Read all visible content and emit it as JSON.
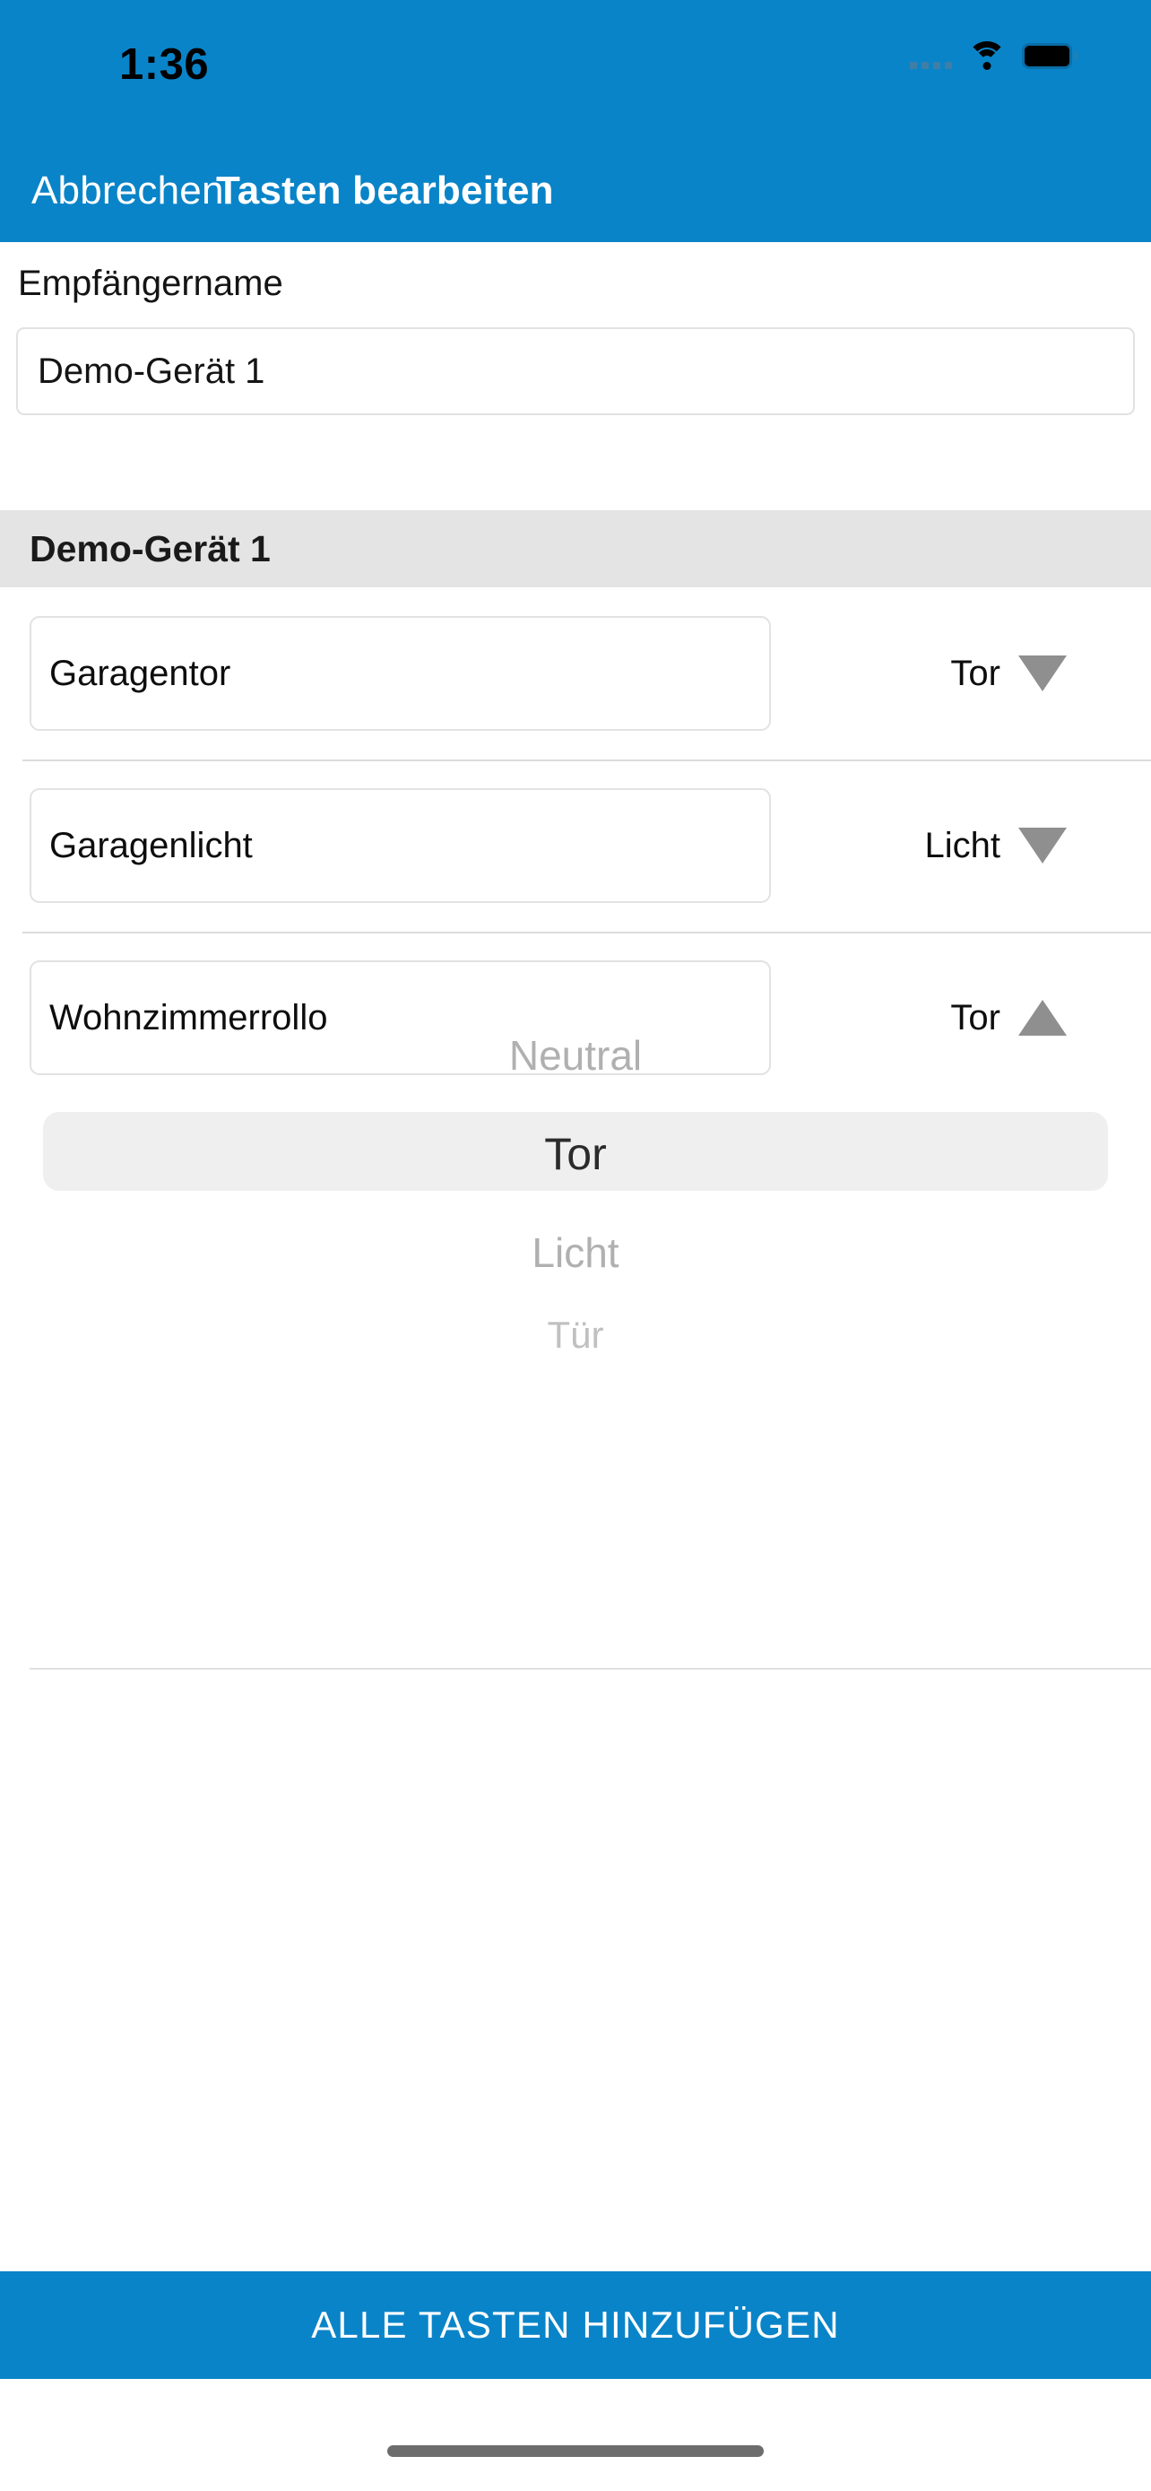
{
  "status_bar": {
    "time": "1:36",
    "signal_icon": "signal-dots-icon",
    "wifi_icon": "wifi-icon",
    "battery_icon": "battery-icon"
  },
  "nav_bar": {
    "cancel_label": "Abbrechen",
    "title": "Tasten bearbeiten"
  },
  "form": {
    "receiver_name_label": "Empfängername",
    "receiver_name_value": "Demo-Gerät 1",
    "receiver_name_placeholder": "Empfängername"
  },
  "section": {
    "header": "Demo-Gerät 1"
  },
  "keys": [
    {
      "name": "Garagentor",
      "type": "Tor",
      "toggle_icon": "chevron-down-icon",
      "expanded": false
    },
    {
      "name": "Garagenlicht",
      "type": "Licht",
      "toggle_icon": "chevron-down-icon",
      "expanded": false
    },
    {
      "name": "Wohnzimmerrollo",
      "type": "Tor",
      "toggle_icon": "chevron-up-icon",
      "expanded": true
    }
  ],
  "picker": {
    "options": [
      "Neutral",
      "Tor",
      "Licht",
      "Tür"
    ],
    "selected": "Tor",
    "selected_index": 1
  },
  "footer": {
    "add_all_label": "ALLE TASTEN HINZUFÜGEN"
  },
  "colors": {
    "accent": "#0a84c8",
    "section_bg": "#e4e4e4",
    "selection_bg": "#efefef",
    "muted_text": "#b0b0b0"
  }
}
